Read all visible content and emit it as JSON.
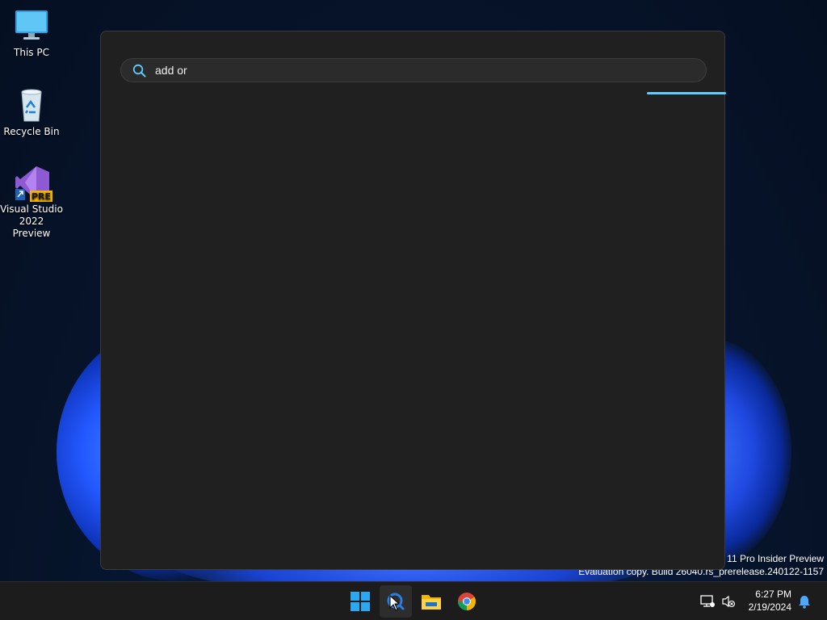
{
  "desktop": {
    "icons": [
      {
        "label": "This PC",
        "icon": "monitor-icon"
      },
      {
        "label": "Recycle Bin",
        "icon": "recycle-bin-icon"
      },
      {
        "label": "Visual Studio\n2022 Preview",
        "icon": "visual-studio-preview-icon",
        "badge": "PRE"
      }
    ],
    "watermark": {
      "line1": "11 Pro Insider Preview",
      "line2": "Evaluation copy. Build 26040.rs_prerelease.240122-1157"
    }
  },
  "search": {
    "query": "add or",
    "accent": "#60cdff"
  },
  "taskbar": {
    "apps": [
      "start-icon",
      "search-app-icon",
      "file-explorer-icon",
      "chrome-icon"
    ],
    "time": "6:27 PM",
    "date": "2/19/2024"
  }
}
